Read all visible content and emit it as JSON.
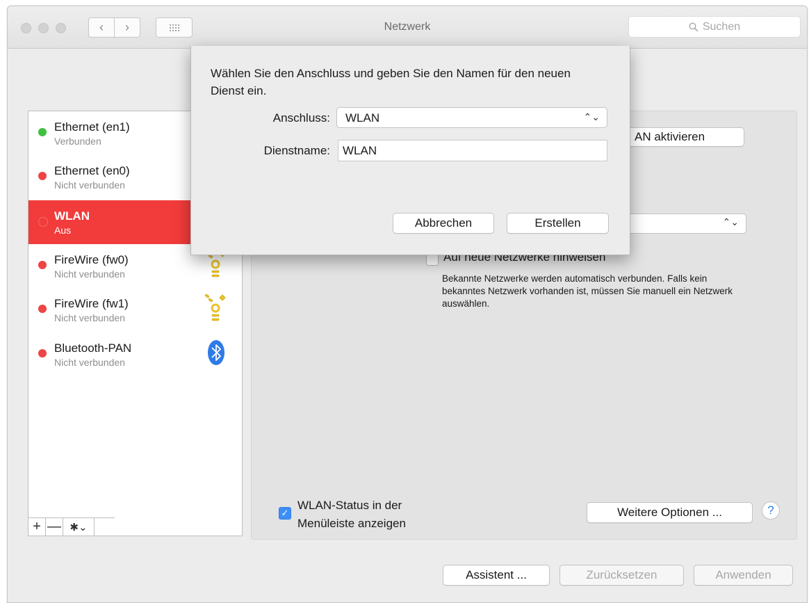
{
  "window": {
    "title": "Netzwerk",
    "search_placeholder": "Suchen",
    "nav_back": "‹",
    "nav_forward": "›"
  },
  "services": [
    {
      "name": "Ethernet (en1)",
      "status": "Verbunden",
      "state": "connected",
      "icon": null,
      "selected": false
    },
    {
      "name": "Ethernet (en0)",
      "status": "Nicht verbunden",
      "state": "disconnected",
      "icon": null,
      "selected": false
    },
    {
      "name": "WLAN",
      "status": "Aus",
      "state": "off",
      "icon": null,
      "selected": true
    },
    {
      "name": "FireWire (fw0)",
      "status": "Nicht verbunden",
      "state": "disconnected",
      "icon": "firewire-icon",
      "selected": false
    },
    {
      "name": "FireWire (fw1)",
      "status": "Nicht verbunden",
      "state": "disconnected",
      "icon": "firewire-icon",
      "selected": false
    },
    {
      "name": "Bluetooth-PAN",
      "status": "Nicht verbunden",
      "state": "disconnected",
      "icon": "bluetooth-icon",
      "selected": false
    }
  ],
  "sidebar_toolbar": {
    "add": "+",
    "remove": "—",
    "gear": "✱⌄"
  },
  "right_panel": {
    "wlan_toggle_label": "AN aktivieren",
    "ask_networks_label": "Auf neue Netzwerke hinweisen",
    "description": "Bekannte Netzwerke werden automatisch verbunden. Falls kein bekanntes Netzwerk vorhanden ist, müssen Sie manuell ein Netzwerk auswählen.",
    "menubar_status_line1": "WLAN-Status in der",
    "menubar_status_line2": "Menüleiste anzeigen",
    "menubar_status_checked": true,
    "more_options_label": "Weitere Optionen ...",
    "help_label": "?"
  },
  "footer": {
    "assistant_label": "Assistent ...",
    "reset_label": "Zurücksetzen",
    "apply_label": "Anwenden"
  },
  "sheet": {
    "message": "Wählen Sie den Anschluss und geben Sie den Namen für den neuen Dienst ein.",
    "interface_label": "Anschluss:",
    "interface_value": "WLAN",
    "service_name_label": "Dienstname:",
    "service_name_value": "WLAN",
    "cancel_label": "Abbrechen",
    "create_label": "Erstellen"
  },
  "colors": {
    "connected": "#3ec13e",
    "disconnected": "#ee4444",
    "selection": "#f23b3b",
    "accent": "#2f7de8"
  }
}
